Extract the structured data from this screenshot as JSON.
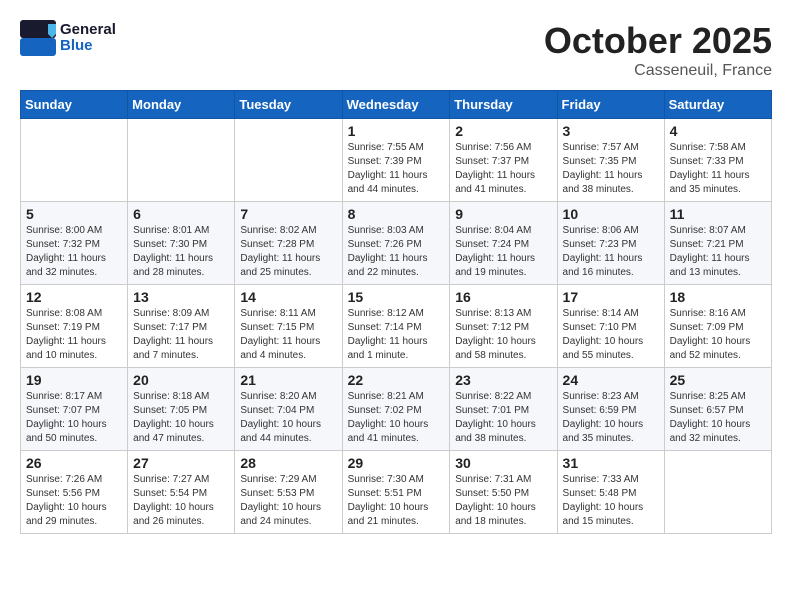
{
  "header": {
    "logo_line1": "General",
    "logo_line2": "Blue",
    "month": "October 2025",
    "location": "Casseneuil, France"
  },
  "weekdays": [
    "Sunday",
    "Monday",
    "Tuesday",
    "Wednesday",
    "Thursday",
    "Friday",
    "Saturday"
  ],
  "weeks": [
    [
      {
        "day": "",
        "info": ""
      },
      {
        "day": "",
        "info": ""
      },
      {
        "day": "",
        "info": ""
      },
      {
        "day": "1",
        "info": "Sunrise: 7:55 AM\nSunset: 7:39 PM\nDaylight: 11 hours\nand 44 minutes."
      },
      {
        "day": "2",
        "info": "Sunrise: 7:56 AM\nSunset: 7:37 PM\nDaylight: 11 hours\nand 41 minutes."
      },
      {
        "day": "3",
        "info": "Sunrise: 7:57 AM\nSunset: 7:35 PM\nDaylight: 11 hours\nand 38 minutes."
      },
      {
        "day": "4",
        "info": "Sunrise: 7:58 AM\nSunset: 7:33 PM\nDaylight: 11 hours\nand 35 minutes."
      }
    ],
    [
      {
        "day": "5",
        "info": "Sunrise: 8:00 AM\nSunset: 7:32 PM\nDaylight: 11 hours\nand 32 minutes."
      },
      {
        "day": "6",
        "info": "Sunrise: 8:01 AM\nSunset: 7:30 PM\nDaylight: 11 hours\nand 28 minutes."
      },
      {
        "day": "7",
        "info": "Sunrise: 8:02 AM\nSunset: 7:28 PM\nDaylight: 11 hours\nand 25 minutes."
      },
      {
        "day": "8",
        "info": "Sunrise: 8:03 AM\nSunset: 7:26 PM\nDaylight: 11 hours\nand 22 minutes."
      },
      {
        "day": "9",
        "info": "Sunrise: 8:04 AM\nSunset: 7:24 PM\nDaylight: 11 hours\nand 19 minutes."
      },
      {
        "day": "10",
        "info": "Sunrise: 8:06 AM\nSunset: 7:23 PM\nDaylight: 11 hours\nand 16 minutes."
      },
      {
        "day": "11",
        "info": "Sunrise: 8:07 AM\nSunset: 7:21 PM\nDaylight: 11 hours\nand 13 minutes."
      }
    ],
    [
      {
        "day": "12",
        "info": "Sunrise: 8:08 AM\nSunset: 7:19 PM\nDaylight: 11 hours\nand 10 minutes."
      },
      {
        "day": "13",
        "info": "Sunrise: 8:09 AM\nSunset: 7:17 PM\nDaylight: 11 hours\nand 7 minutes."
      },
      {
        "day": "14",
        "info": "Sunrise: 8:11 AM\nSunset: 7:15 PM\nDaylight: 11 hours\nand 4 minutes."
      },
      {
        "day": "15",
        "info": "Sunrise: 8:12 AM\nSunset: 7:14 PM\nDaylight: 11 hours\nand 1 minute."
      },
      {
        "day": "16",
        "info": "Sunrise: 8:13 AM\nSunset: 7:12 PM\nDaylight: 10 hours\nand 58 minutes."
      },
      {
        "day": "17",
        "info": "Sunrise: 8:14 AM\nSunset: 7:10 PM\nDaylight: 10 hours\nand 55 minutes."
      },
      {
        "day": "18",
        "info": "Sunrise: 8:16 AM\nSunset: 7:09 PM\nDaylight: 10 hours\nand 52 minutes."
      }
    ],
    [
      {
        "day": "19",
        "info": "Sunrise: 8:17 AM\nSunset: 7:07 PM\nDaylight: 10 hours\nand 50 minutes."
      },
      {
        "day": "20",
        "info": "Sunrise: 8:18 AM\nSunset: 7:05 PM\nDaylight: 10 hours\nand 47 minutes."
      },
      {
        "day": "21",
        "info": "Sunrise: 8:20 AM\nSunset: 7:04 PM\nDaylight: 10 hours\nand 44 minutes."
      },
      {
        "day": "22",
        "info": "Sunrise: 8:21 AM\nSunset: 7:02 PM\nDaylight: 10 hours\nand 41 minutes."
      },
      {
        "day": "23",
        "info": "Sunrise: 8:22 AM\nSunset: 7:01 PM\nDaylight: 10 hours\nand 38 minutes."
      },
      {
        "day": "24",
        "info": "Sunrise: 8:23 AM\nSunset: 6:59 PM\nDaylight: 10 hours\nand 35 minutes."
      },
      {
        "day": "25",
        "info": "Sunrise: 8:25 AM\nSunset: 6:57 PM\nDaylight: 10 hours\nand 32 minutes."
      }
    ],
    [
      {
        "day": "26",
        "info": "Sunrise: 7:26 AM\nSunset: 5:56 PM\nDaylight: 10 hours\nand 29 minutes."
      },
      {
        "day": "27",
        "info": "Sunrise: 7:27 AM\nSunset: 5:54 PM\nDaylight: 10 hours\nand 26 minutes."
      },
      {
        "day": "28",
        "info": "Sunrise: 7:29 AM\nSunset: 5:53 PM\nDaylight: 10 hours\nand 24 minutes."
      },
      {
        "day": "29",
        "info": "Sunrise: 7:30 AM\nSunset: 5:51 PM\nDaylight: 10 hours\nand 21 minutes."
      },
      {
        "day": "30",
        "info": "Sunrise: 7:31 AM\nSunset: 5:50 PM\nDaylight: 10 hours\nand 18 minutes."
      },
      {
        "day": "31",
        "info": "Sunrise: 7:33 AM\nSunset: 5:48 PM\nDaylight: 10 hours\nand 15 minutes."
      },
      {
        "day": "",
        "info": ""
      }
    ]
  ]
}
